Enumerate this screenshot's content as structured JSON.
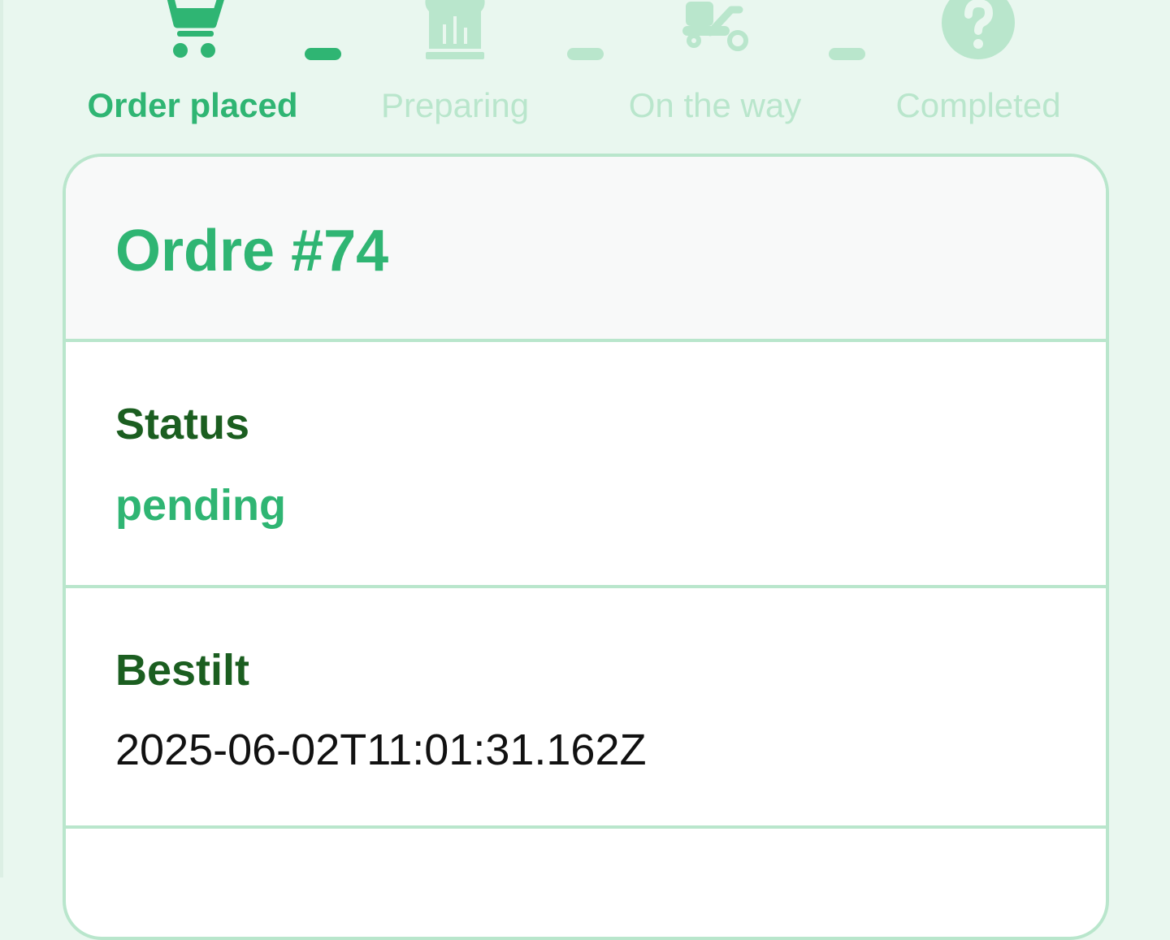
{
  "tracker": {
    "steps": [
      {
        "label": "Order placed",
        "icon": "shopping-cart-icon",
        "state": "active"
      },
      {
        "label": "Preparing",
        "icon": "chef-hat-icon",
        "state": "pending"
      },
      {
        "label": "On the way",
        "icon": "scooter-icon",
        "state": "pending"
      },
      {
        "label": "Completed",
        "icon": "question-circle-icon",
        "state": "pending"
      }
    ]
  },
  "order": {
    "title": "Ordre #74",
    "status_label": "Status",
    "status_value": "pending",
    "ordered_label": "Bestilt",
    "ordered_value": "2025-06-02T11:01:31.162Z"
  },
  "colors": {
    "accent": "#2fb573",
    "accent_light": "#b9e6cc",
    "label_dark": "#1b5e20",
    "background": "#e9f7ef"
  }
}
